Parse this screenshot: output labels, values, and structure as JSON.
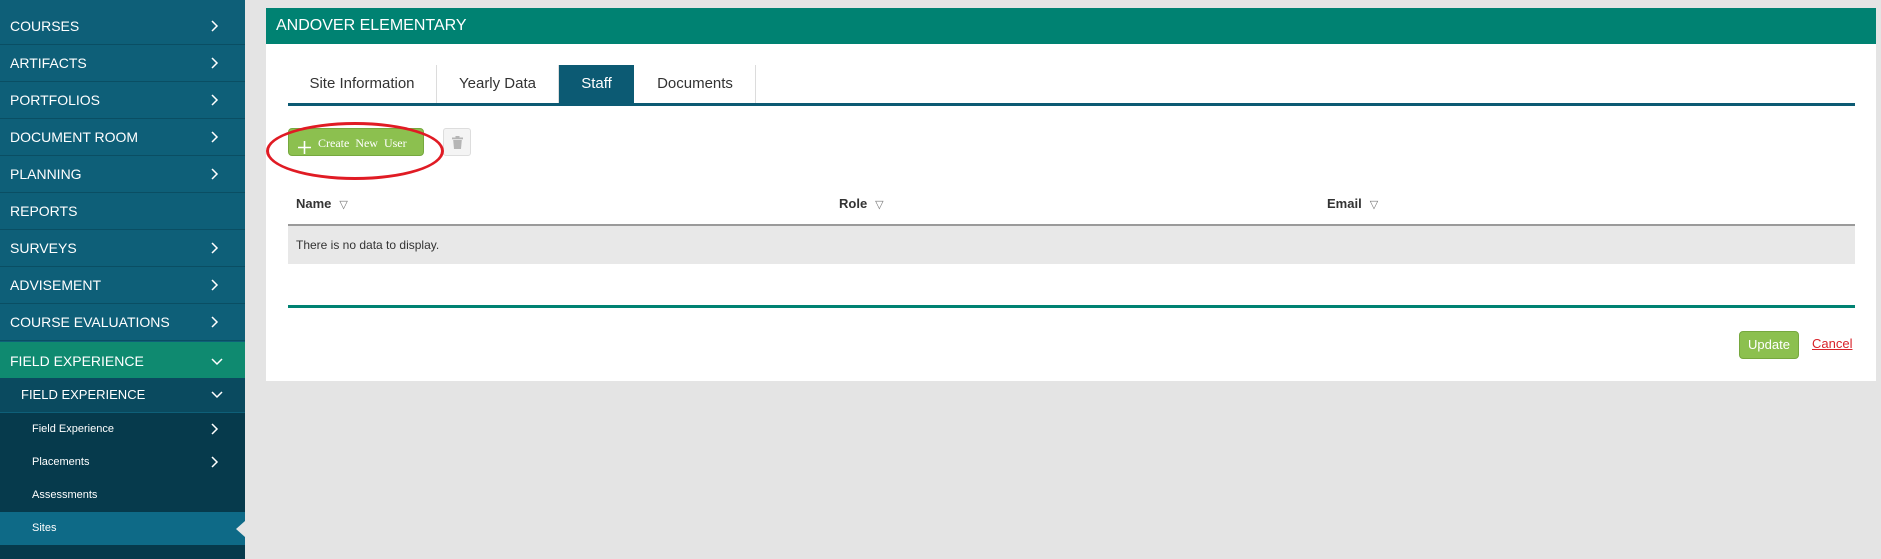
{
  "sidebar": {
    "items": [
      {
        "label": "COURSES",
        "chevron": "right"
      },
      {
        "label": "ARTIFACTS",
        "chevron": "right"
      },
      {
        "label": "PORTFOLIOS",
        "chevron": "right"
      },
      {
        "label": "DOCUMENT ROOM",
        "chevron": "right"
      },
      {
        "label": "PLANNING",
        "chevron": "right"
      },
      {
        "label": "REPORTS",
        "chevron": "none"
      },
      {
        "label": "SURVEYS",
        "chevron": "right"
      },
      {
        "label": "ADVISEMENT",
        "chevron": "right"
      },
      {
        "label": "COURSE EVALUATIONS",
        "chevron": "right"
      },
      {
        "label": "FIELD EXPERIENCE",
        "chevron": "down",
        "active": true
      }
    ],
    "submenu": {
      "label": "FIELD EXPERIENCE",
      "chevron": "down"
    },
    "leaves": [
      {
        "label": "Field Experience",
        "chevron": "right"
      },
      {
        "label": "Placements",
        "chevron": "right"
      },
      {
        "label": "Assessments",
        "chevron": "none"
      },
      {
        "label": "Sites",
        "chevron": "none",
        "selected": true
      }
    ]
  },
  "panel": {
    "title": "ANDOVER ELEMENTARY",
    "tabs": [
      {
        "label": "Site Information"
      },
      {
        "label": "Yearly Data"
      },
      {
        "label": "Staff",
        "active": true
      },
      {
        "label": "Documents"
      }
    ],
    "toolbar": {
      "create_label": "Create New User",
      "create_icon": "plus-icon",
      "delete_icon": "trash-icon"
    },
    "grid": {
      "columns": [
        {
          "label": "Name",
          "sort_icon": "sort-triangle-icon"
        },
        {
          "label": "Role",
          "sort_icon": "sort-triangle-icon"
        },
        {
          "label": "Email",
          "sort_icon": "sort-triangle-icon"
        }
      ],
      "empty_message": "There is no data to display."
    },
    "actions": {
      "update_label": "Update",
      "cancel_label": "Cancel"
    }
  },
  "colors": {
    "sidebar_bg": "#0e5f78",
    "sidebar_active": "#0f8a70",
    "header_bg": "#008272",
    "tab_active": "#0c5a73",
    "button_green": "#8cc04f",
    "highlight_red": "#e01b24",
    "cancel_red": "#d8232a"
  }
}
